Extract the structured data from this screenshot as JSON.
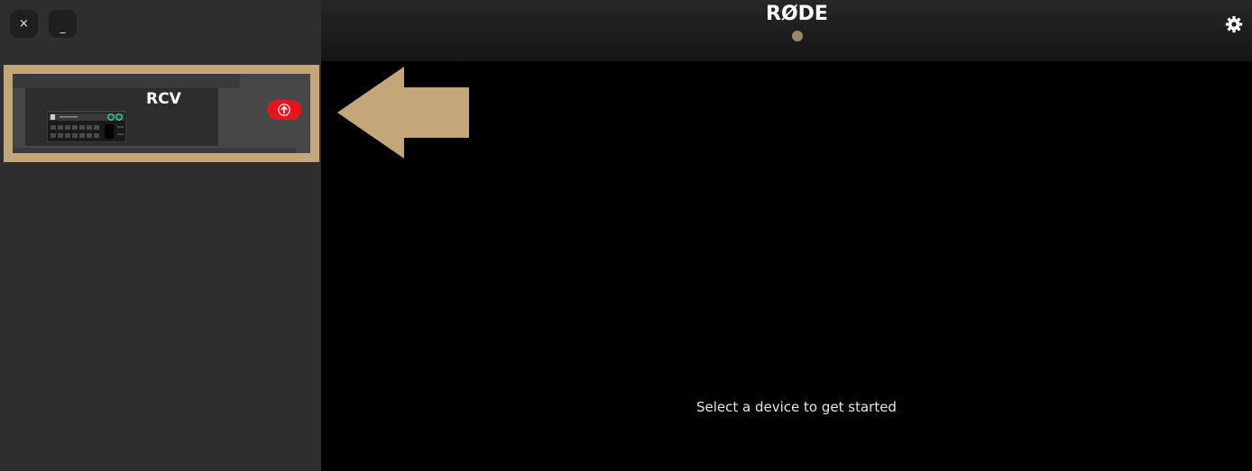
{
  "window": {
    "close_label": "×",
    "minimize_label": "_"
  },
  "header": {
    "logo": "RØDE",
    "status_dot_color": "#9c8765",
    "settings_icon": "gear-icon"
  },
  "sidebar": {
    "devices": [
      {
        "name": "RCV",
        "selected": true,
        "highlight_color": "#c4a778",
        "update_badge": {
          "icon": "arrow-up-icon",
          "color": "#e8141b"
        }
      }
    ]
  },
  "annotation": {
    "arrow_icon": "left-arrow-icon",
    "color": "#c4a778"
  },
  "main": {
    "prompt": "Select a device to get started"
  }
}
